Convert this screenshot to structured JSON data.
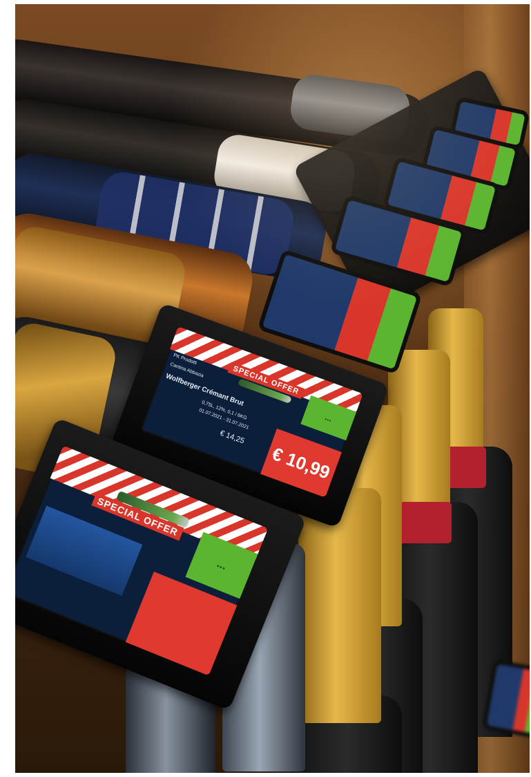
{
  "scene": {
    "description_tag": "wine-shelf-electronic-price-labels"
  },
  "front_display": {
    "banner": "SPECIAL OFFER",
    "green_badge": "..."
  },
  "middle_display": {
    "banner": "SPECIAL OFFER",
    "line1": "PK Prodotti",
    "line2": "Cantina Abbazia",
    "product": "Wolfberger Crémant Brut",
    "detail": "0,75L, 12%, 0,1 / 6KG",
    "validity": "01.07.2021 - 31.07.2021",
    "old_price": "€ 14,25",
    "price": "€ 10,99",
    "green_badge": "..."
  }
}
